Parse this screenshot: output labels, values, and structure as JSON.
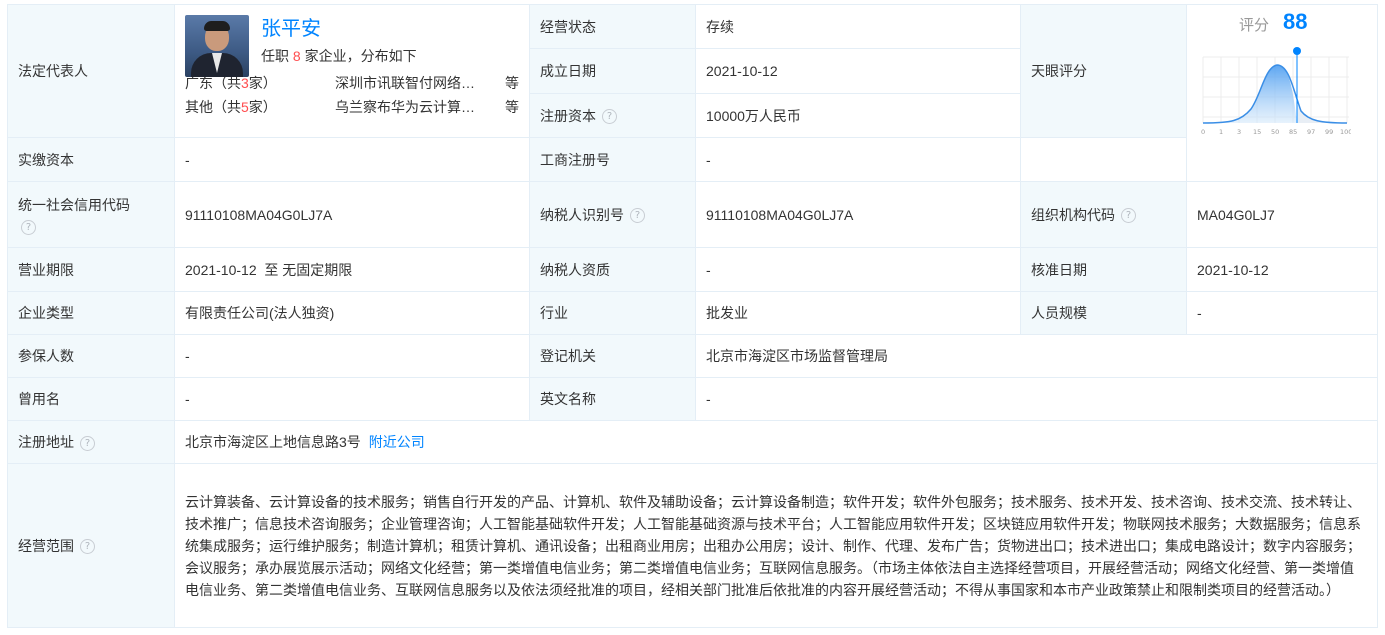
{
  "legal_rep": {
    "label": "法定代表人",
    "name": "张平安",
    "sub_prefix": "任职",
    "count": "8",
    "sub_suffix": "家企业，分布如下",
    "regions": [
      {
        "region_prefix": "广东（共",
        "region_count": "3",
        "region_suffix": "家）",
        "company": "深圳市讯联智付网络…",
        "etc": "等"
      },
      {
        "region_prefix": "其他（共",
        "region_count": "5",
        "region_suffix": "家）",
        "company": "乌兰察布华为云计算…",
        "etc": "等"
      }
    ]
  },
  "rows": {
    "status": {
      "label": "经营状态",
      "value": "存续"
    },
    "founded": {
      "label": "成立日期",
      "value": "2021-10-12"
    },
    "reg_capital": {
      "label": "注册资本",
      "value": "10000万人民币"
    },
    "paid_capital": {
      "label": "实缴资本",
      "value": "-"
    },
    "tianyan": {
      "label": "天眼评分"
    },
    "biz_reg_no": {
      "label": "工商注册号",
      "value": "-"
    },
    "credit_code": {
      "label": "统一社会信用代码",
      "value": "91110108MA04G0LJ7A"
    },
    "taxpayer_id": {
      "label": "纳税人识别号",
      "value": "91110108MA04G0LJ7A"
    },
    "org_code": {
      "label": "组织机构代码",
      "value": "MA04G0LJ7"
    },
    "term": {
      "label": "营业期限",
      "value": "2021-10-12  至 无固定期限"
    },
    "taxpayer_qual": {
      "label": "纳税人资质",
      "value": "-"
    },
    "approval_date": {
      "label": "核准日期",
      "value": "2021-10-12"
    },
    "company_type": {
      "label": "企业类型",
      "value": "有限责任公司(法人独资)"
    },
    "industry": {
      "label": "行业",
      "value": "批发业"
    },
    "staff_size": {
      "label": "人员规模",
      "value": "-"
    },
    "insured": {
      "label": "参保人数",
      "value": "-"
    },
    "reg_authority": {
      "label": "登记机关",
      "value": "北京市海淀区市场监督管理局"
    },
    "former_name": {
      "label": "曾用名",
      "value": "-"
    },
    "english_name": {
      "label": "英文名称",
      "value": "-"
    },
    "address": {
      "label": "注册地址",
      "value": "北京市海淀区上地信息路3号",
      "link": "附近公司"
    },
    "scope": {
      "label": "经营范围",
      "value": "云计算装备、云计算设备的技术服务；销售自行开发的产品、计算机、软件及辅助设备；云计算设备制造；软件开发；软件外包服务；技术服务、技术开发、技术咨询、技术交流、技术转让、技术推广；信息技术咨询服务；企业管理咨询；人工智能基础软件开发；人工智能基础资源与技术平台；人工智能应用软件开发；区块链应用软件开发；物联网技术服务；大数据服务；信息系统集成服务；运行维护服务；制造计算机；租赁计算机、通讯设备；出租商业用房；出租办公用房；设计、制作、代理、发布广告；货物进出口；技术进出口；集成电路设计；数字内容服务；会议服务；承办展览展示活动；网络文化经营；第一类增值电信业务；第二类增值电信业务；互联网信息服务。（市场主体依法自主选择经营项目，开展经营活动；网络文化经营、第一类增值电信业务、第二类增值电信业务、互联网信息服务以及依法须经批准的项目，经相关部门批准后依批准的内容开展经营活动；不得从事国家和本市产业政策禁止和限制类项目的经营活动。）"
    }
  },
  "score": {
    "label": "评分",
    "value": 88,
    "axis_ticks": [
      "0",
      "1",
      "3",
      "15",
      "50",
      "85",
      "97",
      "99",
      "100"
    ],
    "color": "#0084ff"
  },
  "icons": {
    "help": "?"
  },
  "colors": {
    "label_bg": "#f2f9fc",
    "border": "#e4eef6",
    "link": "#0084ff",
    "count_red": "#ff4d4f"
  }
}
